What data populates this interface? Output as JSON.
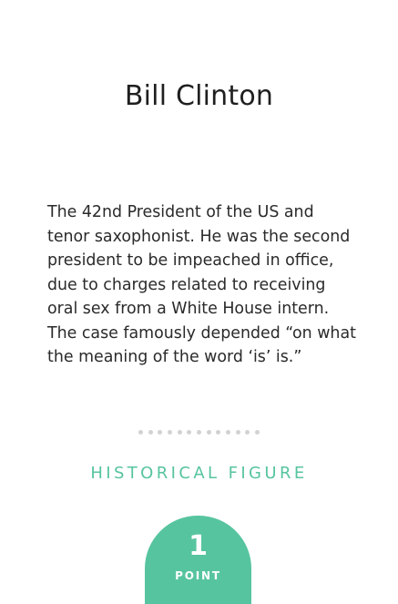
{
  "card": {
    "title": "Bill Clinton",
    "description": "The 42nd President of the US and tenor saxophonist. He was the second president to be impeached in office, due to charges related to receiving oral sex from a White House intern. The case famously depended “on what the meaning of the word ‘is’ is.”",
    "category": "HISTORICAL FIGURE",
    "points": {
      "value": "1",
      "label": "POINT"
    },
    "divider_dot_count": 13
  },
  "colors": {
    "accent": "#57c4a0",
    "text": "#222222",
    "divider": "#d2d2d2",
    "background": "#ffffff"
  }
}
